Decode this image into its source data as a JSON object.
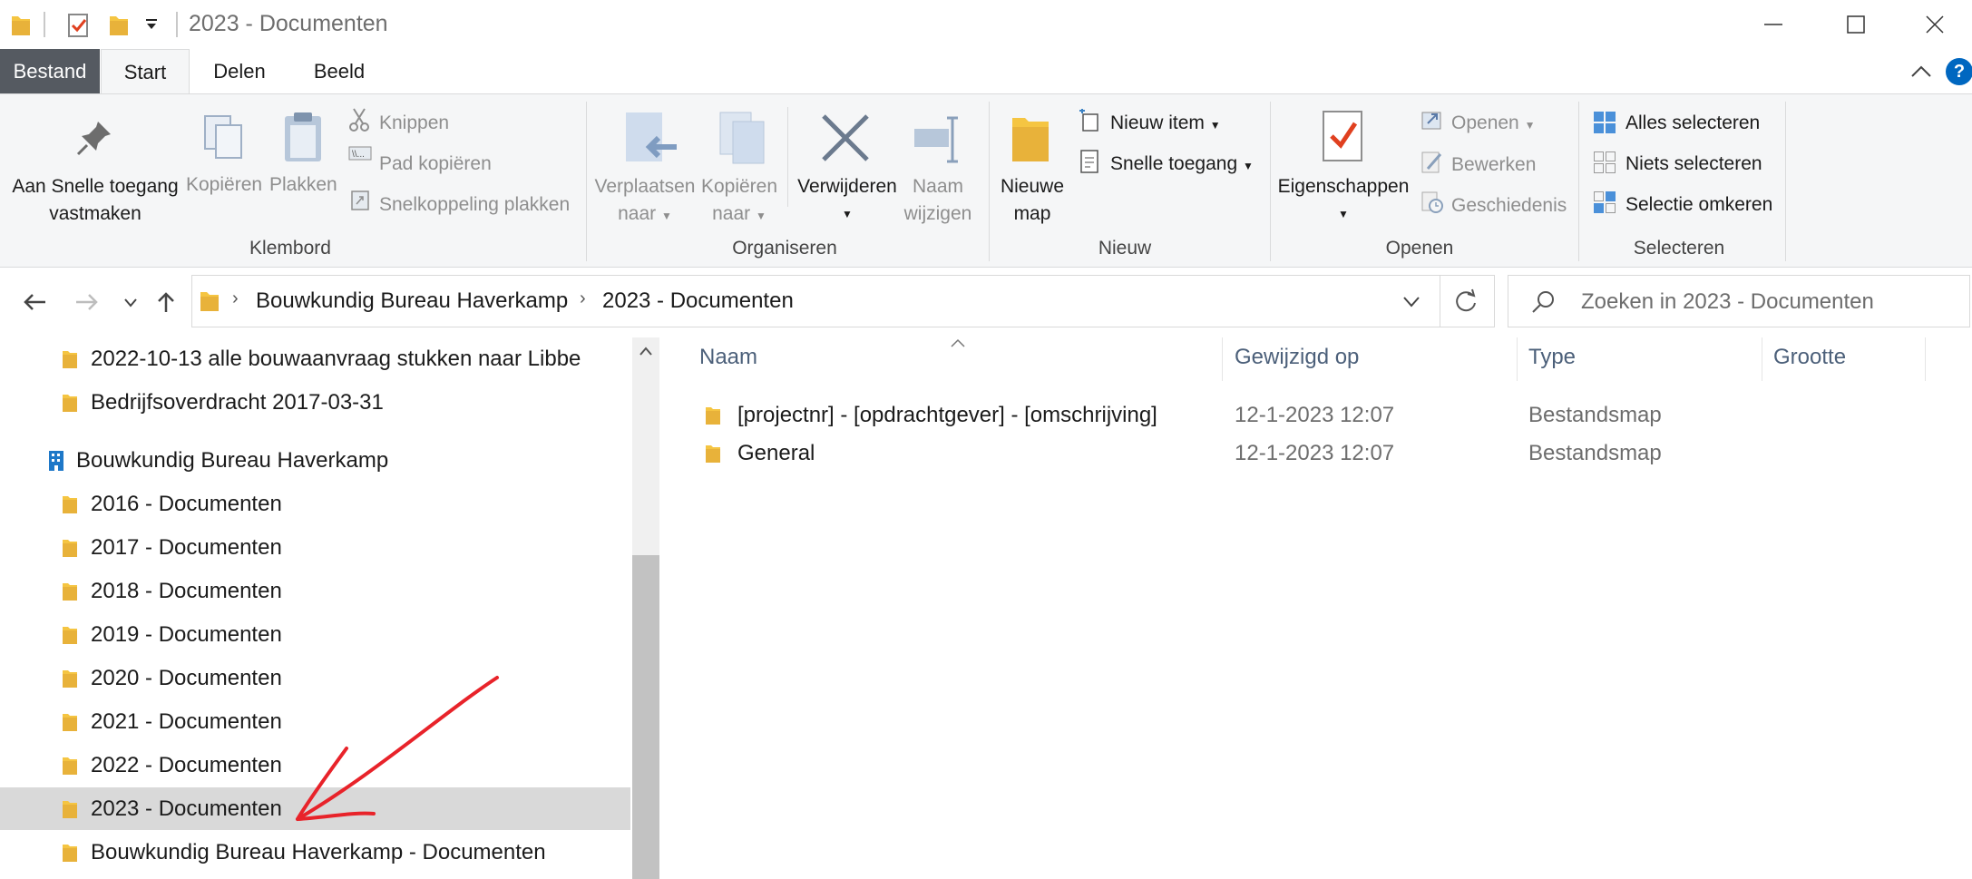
{
  "window": {
    "title": "2023 - Documenten"
  },
  "tabs": [
    "Bestand",
    "Start",
    "Delen",
    "Beeld"
  ],
  "ribbon": {
    "clipboard": {
      "pin_line1": "Aan Snelle toegang",
      "pin_line2": "vastmaken",
      "copy": "Kopiëren",
      "paste": "Plakken",
      "cut": "Knippen",
      "copy_path": "Pad kopiëren",
      "paste_shortcut": "Snelkoppeling plakken",
      "group_label": "Klembord"
    },
    "organize": {
      "move_line1": "Verplaatsen",
      "move_line2": "naar",
      "copyto_line1": "Kopiëren",
      "copyto_line2": "naar",
      "delete": "Verwijderen",
      "rename_line1": "Naam",
      "rename_line2": "wijzigen",
      "group_label": "Organiseren"
    },
    "new": {
      "folder_line1": "Nieuwe",
      "folder_line2": "map",
      "new_item": "Nieuw item",
      "easy_access": "Snelle toegang",
      "group_label": "Nieuw"
    },
    "open": {
      "properties": "Eigenschappen",
      "open": "Openen",
      "edit": "Bewerken",
      "history": "Geschiedenis",
      "group_label": "Openen"
    },
    "select": {
      "select_all": "Alles selecteren",
      "select_none": "Niets selecteren",
      "invert": "Selectie omkeren",
      "group_label": "Selecteren"
    }
  },
  "address": {
    "crumbs": [
      "Bouwkundig Bureau Haverkamp",
      "2023 - Documenten"
    ],
    "search_placeholder": "Zoeken in 2023 - Documenten"
  },
  "navpane": {
    "items": [
      "2022-10-13 alle bouwaanvraag stukken naar  Libbe",
      "Bedrijfsoverdracht 2017-03-31",
      "Bouwkundig Bureau Haverkamp",
      "2016 - Documenten",
      "2017 - Documenten",
      "2018 - Documenten",
      "2019 - Documenten",
      "2020 - Documenten",
      "2021 - Documenten",
      "2022 - Documenten",
      "2023 - Documenten",
      "Bouwkundig Bureau Haverkamp - Documenten"
    ]
  },
  "columns": [
    "Naam",
    "Gewijzigd op",
    "Type",
    "Grootte"
  ],
  "files": [
    {
      "name": "[projectnr] - [opdrachtgever] - [omschrijving]",
      "modified": "12-1-2023 12:07",
      "type": "Bestandsmap",
      "size": ""
    },
    {
      "name": "General",
      "modified": "12-1-2023 12:07",
      "type": "Bestandsmap",
      "size": ""
    }
  ],
  "colors": {
    "folder": "#f5c542",
    "accent": "#0067c0",
    "annotation": "#e8232a"
  }
}
